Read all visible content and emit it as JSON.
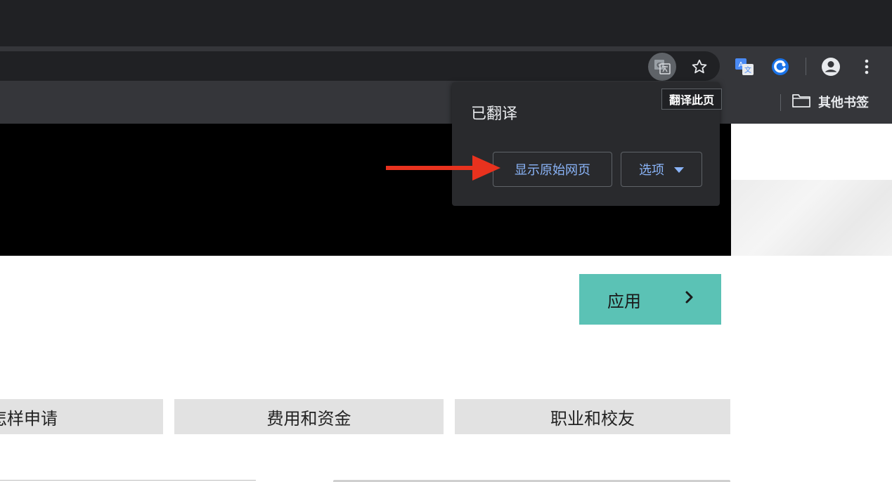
{
  "browser": {
    "tooltip": "翻译此页",
    "bookmarks": {
      "other_label": "其他书签"
    },
    "icons": {
      "translate": "google-translate-icon",
      "star": "star-outline-icon",
      "ext1": "translate-extension-icon",
      "ext2": "blue-extension-icon",
      "profile": "account-circle-icon",
      "menu": "kebab-menu-icon",
      "folder": "folder-icon"
    }
  },
  "translate_bubble": {
    "title": "已翻译",
    "show_original_label": "显示原始网页",
    "options_label": "选项"
  },
  "page": {
    "apply_label": "应用",
    "tabs": [
      "怎样申请",
      "费用和资金",
      "职业和校友"
    ]
  },
  "colors": {
    "accent": "#5bc2b5",
    "link_blue": "#8ab4f8",
    "annotation_red": "#e8321e"
  }
}
